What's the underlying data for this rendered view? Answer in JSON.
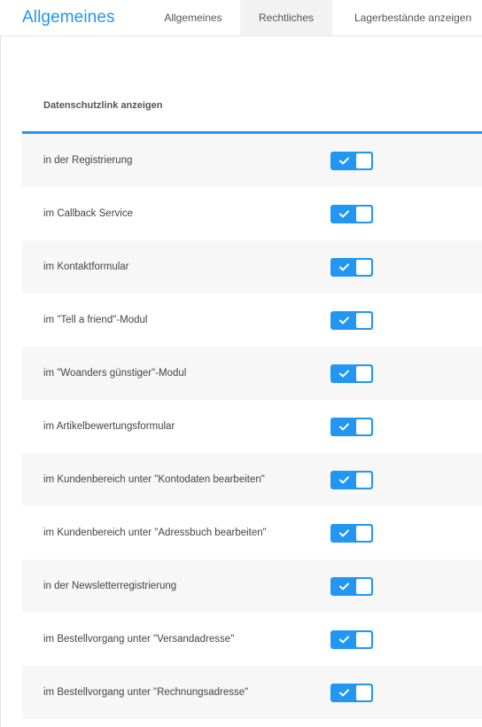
{
  "header": {
    "title": "Allgemeines",
    "tabs": [
      {
        "label": "Allgemeines",
        "active": false
      },
      {
        "label": "Rechtliches",
        "active": true
      },
      {
        "label": "Lagerbestände anzeigen",
        "active": false
      }
    ]
  },
  "section": {
    "title": "Datenschutzlink anzeigen"
  },
  "toggles": [
    {
      "label": "in der Registrierung",
      "checked": true
    },
    {
      "label": "im Callback Service",
      "checked": true
    },
    {
      "label": "im Kontaktformular",
      "checked": true
    },
    {
      "label": "im \"Tell a friend\"-Modul",
      "checked": true
    },
    {
      "label": "im \"Woanders günstiger\"-Modul",
      "checked": true
    },
    {
      "label": "im Artikelbewertungsformular",
      "checked": true
    },
    {
      "label": "im Kundenbereich unter \"Kontodaten bearbeiten\"",
      "checked": true
    },
    {
      "label": "im Kundenbereich unter \"Adressbuch bearbeiten\"",
      "checked": true
    },
    {
      "label": "in der Newsletterregistrierung",
      "checked": true
    },
    {
      "label": "im Bestellvorgang unter \"Versandadresse\"",
      "checked": true
    },
    {
      "label": "im Bestellvorgang unter \"Rechnungsadresse\"",
      "checked": true
    }
  ],
  "colors": {
    "accent": "#2196f3",
    "row_shade": "#f7f7f7",
    "active_tab_bg": "#f2f2f2"
  },
  "icons": {
    "toggle_on": "check-icon"
  }
}
